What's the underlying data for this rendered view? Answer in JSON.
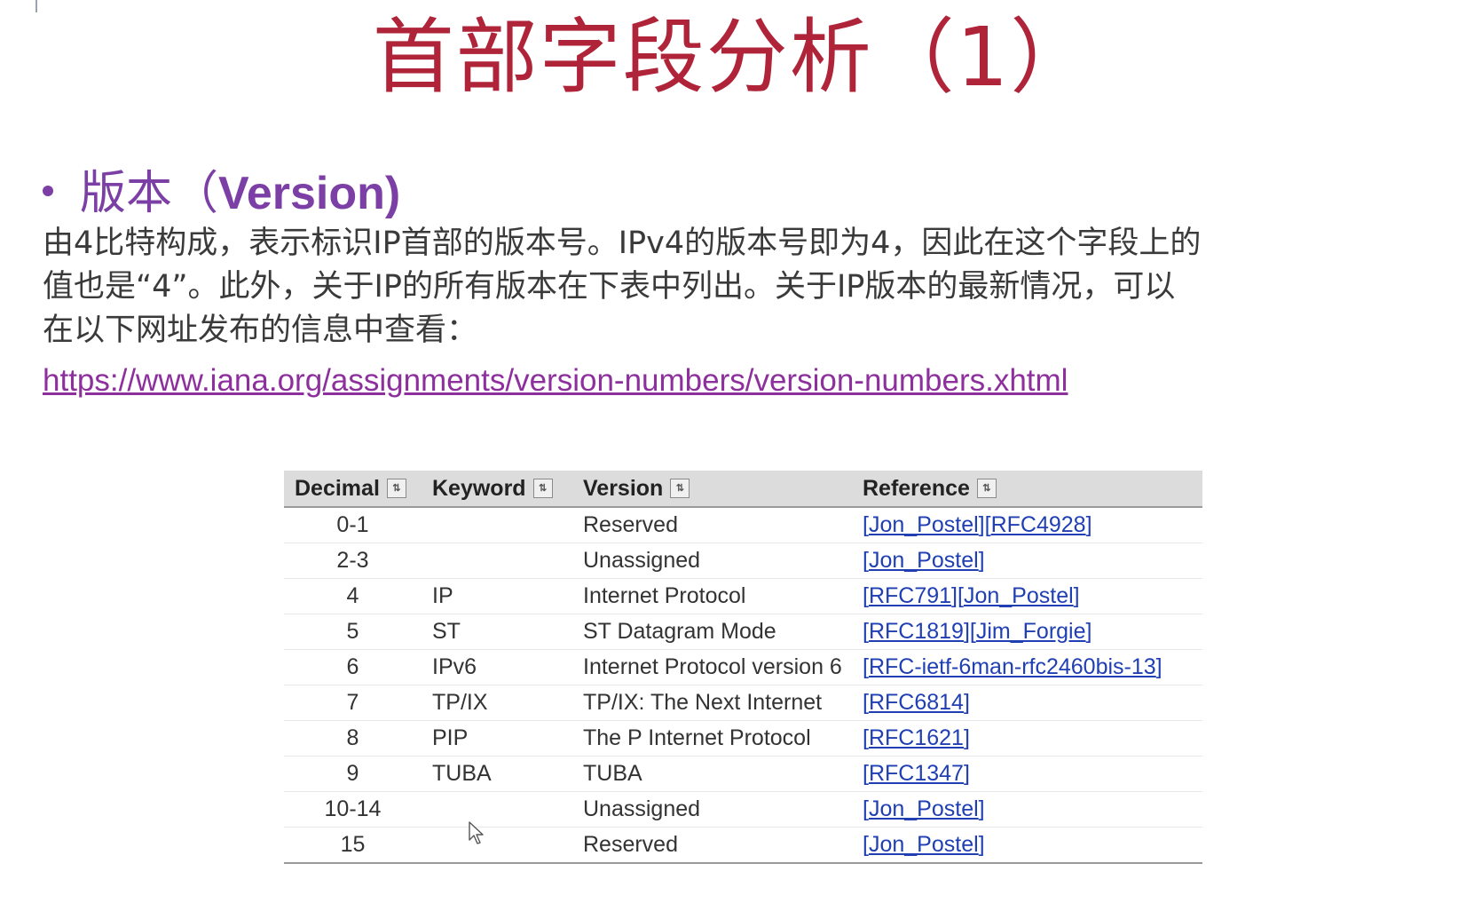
{
  "slide": {
    "title": "首部字段分析（1）",
    "bullet_cn": "版本（",
    "bullet_en": "Version)",
    "paragraph_lines": [
      "由4比特构成，表示标识IP首部的版本号。IPv4的版本号即为4，因此在这个字段上的",
      "值也是“4”。此外，关于IP的所有版本在下表中列出。关于IP版本的最新情况，可以",
      "在以下网址发布的信息中查看："
    ],
    "url": "https://www.iana.org/assignments/version-numbers/version-numbers.xhtml"
  },
  "table": {
    "headers": {
      "decimal": "Decimal",
      "keyword": "Keyword",
      "version": "Version",
      "reference": "Reference"
    },
    "rows": [
      {
        "decimal": "0-1",
        "keyword": "",
        "version": "Reserved",
        "refs": [
          "Jon_Postel",
          "RFC4928"
        ]
      },
      {
        "decimal": "2-3",
        "keyword": "",
        "version": "Unassigned",
        "refs": [
          "Jon_Postel"
        ]
      },
      {
        "decimal": "4",
        "keyword": "IP",
        "version": "Internet Protocol",
        "refs": [
          "RFC791",
          "Jon_Postel"
        ]
      },
      {
        "decimal": "5",
        "keyword": "ST",
        "version": "ST Datagram Mode",
        "refs": [
          "RFC1819",
          "Jim_Forgie"
        ]
      },
      {
        "decimal": "6",
        "keyword": "IPv6",
        "version": "Internet Protocol version 6",
        "refs": [
          "RFC-ietf-6man-rfc2460bis-13"
        ]
      },
      {
        "decimal": "7",
        "keyword": "TP/IX",
        "version": "TP/IX: The Next Internet",
        "refs": [
          "RFC6814"
        ]
      },
      {
        "decimal": "8",
        "keyword": "PIP",
        "version": "The P Internet Protocol",
        "refs": [
          "RFC1621"
        ]
      },
      {
        "decimal": "9",
        "keyword": "TUBA",
        "version": "TUBA",
        "refs": [
          "RFC1347"
        ]
      },
      {
        "decimal": "10-14",
        "keyword": "",
        "version": "Unassigned",
        "refs": [
          "Jon_Postel"
        ]
      },
      {
        "decimal": "15",
        "keyword": "",
        "version": "Reserved",
        "refs": [
          "Jon_Postel"
        ]
      }
    ]
  },
  "colors": {
    "title": "#b0243a",
    "bullet": "#7b3fa5",
    "link": "#1f3fb3",
    "url": "#8d2f9c"
  },
  "icons": [
    "sort-icon",
    "mouse-cursor-icon"
  ]
}
